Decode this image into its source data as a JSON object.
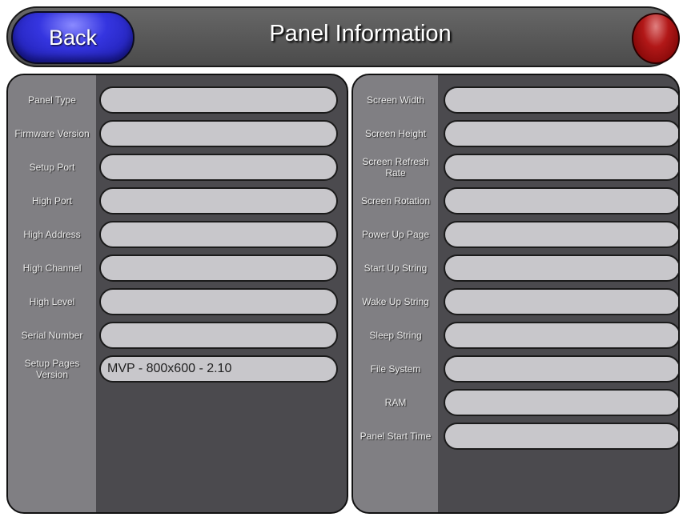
{
  "header": {
    "back_label": "Back",
    "title": "Panel Information"
  },
  "left_panel": {
    "rows": [
      {
        "label": "Panel Type",
        "value": ""
      },
      {
        "label": "Firmware Version",
        "value": ""
      },
      {
        "label": "Setup Port",
        "value": ""
      },
      {
        "label": "High Port",
        "value": ""
      },
      {
        "label": "High Address",
        "value": ""
      },
      {
        "label": "High Channel",
        "value": ""
      },
      {
        "label": "High Level",
        "value": ""
      },
      {
        "label": "Serial Number",
        "value": ""
      },
      {
        "label": "Setup Pages Version",
        "value": "MVP - 800x600 - 2.10"
      }
    ]
  },
  "right_panel": {
    "rows": [
      {
        "label": "Screen Width",
        "value": ""
      },
      {
        "label": "Screen Height",
        "value": ""
      },
      {
        "label": "Screen Refresh Rate",
        "value": ""
      },
      {
        "label": "Screen Rotation",
        "value": ""
      },
      {
        "label": "Power Up Page",
        "value": ""
      },
      {
        "label": "Start Up String",
        "value": ""
      },
      {
        "label": "Wake Up String",
        "value": ""
      },
      {
        "label": "Sleep String",
        "value": ""
      },
      {
        "label": "File System",
        "value": ""
      },
      {
        "label": "RAM",
        "value": ""
      },
      {
        "label": "Panel Start Time",
        "value": ""
      }
    ]
  },
  "colors": {
    "back_button": "#2b2bd0",
    "indicator": "#a01010",
    "panel_bg": "#4b4a4e",
    "label_column": "#807f83",
    "field_bg": "#c8c7cb"
  }
}
